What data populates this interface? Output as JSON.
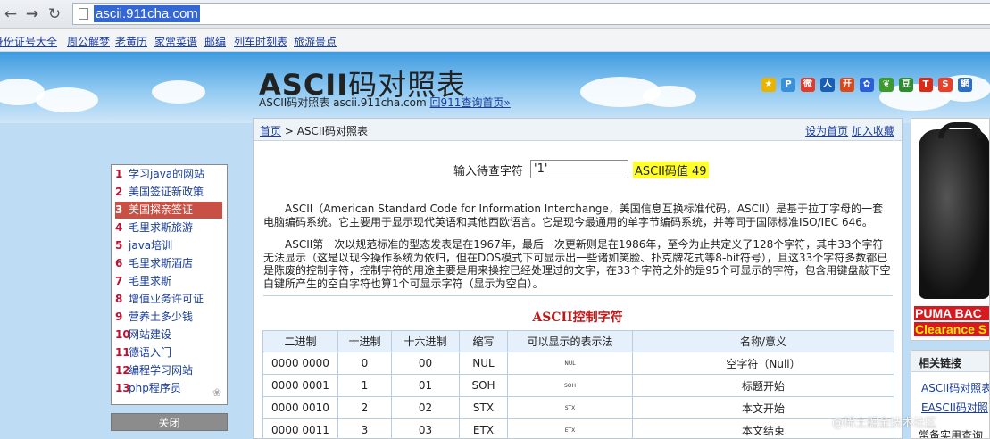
{
  "browser": {
    "url": "ascii.911cha.com",
    "bookmarks": [
      "身份证号大全",
      "周公解梦",
      "老黄历",
      "家常菜谱",
      "邮编",
      "列车时刻表",
      "旅游景点"
    ]
  },
  "header": {
    "title_latin": "ASCII",
    "title_cn": "码对照表",
    "subtitle": "ASCII码对照表 ascii.911cha.com",
    "home_link": "回911查询首页»",
    "share_icons": [
      {
        "icon": "qzone-star-icon",
        "color": "#e8b400",
        "glyph": "★"
      },
      {
        "icon": "pengyou-icon",
        "color": "#3a8fd8",
        "glyph": "P"
      },
      {
        "icon": "weibo-icon",
        "color": "#e03b2b",
        "glyph": "微"
      },
      {
        "icon": "renren-icon",
        "color": "#1a5fb4",
        "glyph": "人"
      },
      {
        "icon": "kaixin-icon",
        "color": "#d84a1b",
        "glyph": "开"
      },
      {
        "icon": "baidu-paw-icon",
        "color": "#2b5fd6",
        "glyph": "✿"
      },
      {
        "icon": "douban-leaf-icon",
        "color": "#3d9a2e",
        "glyph": "❦"
      },
      {
        "icon": "douban-icon",
        "color": "#2e8b2e",
        "glyph": "豆"
      },
      {
        "icon": "netease-icon",
        "color": "#d62c1a",
        "glyph": "T"
      },
      {
        "icon": "sohu-icon",
        "color": "#e8402a",
        "glyph": "S"
      },
      {
        "icon": "bookmark-icon",
        "color": "#2a6fc4",
        "glyph": "網"
      }
    ]
  },
  "sidebar": {
    "items": [
      {
        "num": "1",
        "label": "学习java的网站"
      },
      {
        "num": "2",
        "label": "美国签证新政策"
      },
      {
        "num": "3",
        "label": "美国探亲签证"
      },
      {
        "num": "4",
        "label": "毛里求斯旅游"
      },
      {
        "num": "5",
        "label": "java培训"
      },
      {
        "num": "6",
        "label": "毛里求斯酒店"
      },
      {
        "num": "7",
        "label": "毛里求斯"
      },
      {
        "num": "8",
        "label": "增值业务许可证"
      },
      {
        "num": "9",
        "label": "营养土多少钱"
      },
      {
        "num": "10",
        "label": "网站建设"
      },
      {
        "num": "11",
        "label": "德语入门"
      },
      {
        "num": "12",
        "label": "编程学习网站"
      },
      {
        "num": "13",
        "label": "php程序员"
      }
    ],
    "close_label": "关闭"
  },
  "main": {
    "breadcrumb_home": "首页",
    "breadcrumb_current": " > ASCII码对照表",
    "set_home": "设为首页",
    "add_fav": "加入收藏",
    "input_label": "输入待查字符",
    "input_value": "'1'",
    "result": "ASCII码值 49",
    "para1": "ASCII（American Standard Code for Information Interchange，美国信息互换标准代码，ASCII）是基于拉丁字母的一套电脑编码系统。它主要用于显示现代英语和其他西欧语言。它是现今最通用的单字节编码系统，并等同于国际标准ISO/IEC 646。",
    "para2": "ASCII第一次以规范标准的型态发表是在1967年，最后一次更新则是在1986年，至今为止共定义了128个字符，其中33个字符无法显示（这是以现今操作系统为依归，但在DOS模式下可显示出一些诸如笑脸、扑克牌花式等8-bit符号），且这33个字符多数都已是陈废的控制字符，控制字符的用途主要是用来操控已经处理过的文字，在33个字符之外的是95个可显示的字符，包含用键盘敲下空白键所产生的空白字符也算1个可显示字符（显示为空白）。",
    "section_title": "ASCII控制字符",
    "table": {
      "headers": [
        "二进制",
        "十进制",
        "十六进制",
        "缩写",
        "可以显示的表示法",
        "名称/意义"
      ],
      "rows": [
        [
          "0000 0000",
          "0",
          "00",
          "NUL",
          "NUL",
          "空字符（Null）"
        ],
        [
          "0000 0001",
          "1",
          "01",
          "SOH",
          "SOH",
          "标题开始"
        ],
        [
          "0000 0010",
          "2",
          "02",
          "STX",
          "STX",
          "本文开始"
        ],
        [
          "0000 0011",
          "3",
          "03",
          "ETX",
          "ETX",
          "本文结束"
        ]
      ]
    }
  },
  "ad": {
    "line1": "PUMA BAC",
    "line2": "Clearance S"
  },
  "related": {
    "title": "相关链接",
    "links": [
      "ASCII码对照表",
      "EASCII码对照"
    ],
    "caption": "常备实用查询"
  },
  "watermark": "@稀土掘金技术社区"
}
